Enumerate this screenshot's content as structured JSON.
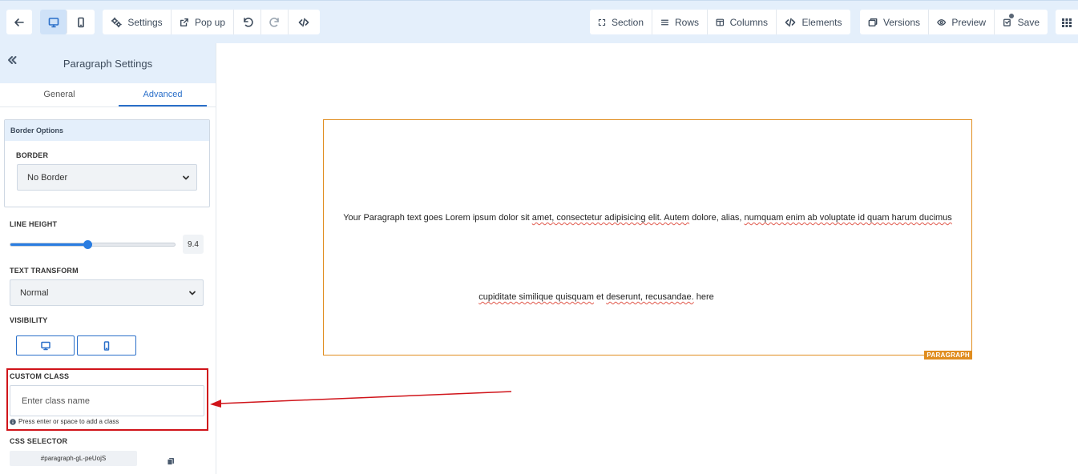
{
  "toolbar": {
    "settings_label": "Settings",
    "popup_label": "Pop up",
    "section_label": "Section",
    "rows_label": "Rows",
    "columns_label": "Columns",
    "elements_label": "Elements",
    "versions_label": "Versions",
    "preview_label": "Preview",
    "save_label": "Save"
  },
  "sidebar": {
    "title": "Paragraph Settings",
    "tabs": [
      {
        "label": "General",
        "active": false
      },
      {
        "label": "Advanced",
        "active": true
      }
    ],
    "border_options": {
      "heading": "Border Options",
      "border_label": "BORDER",
      "border_value": "No Border"
    },
    "line_height": {
      "label": "LINE HEIGHT",
      "value": "9.4",
      "fill_fraction": 0.47
    },
    "text_transform": {
      "label": "TEXT TRANSFORM",
      "value": "Normal"
    },
    "visibility": {
      "label": "VISIBILITY"
    },
    "custom_class": {
      "label": "CUSTOM CLASS",
      "placeholder": "Enter class name",
      "help": "Press enter or space to add a class"
    },
    "css_selector": {
      "label": "CSS SELECTOR",
      "value": "#paragraph-gL-peUojS"
    }
  },
  "canvas": {
    "paragraph": {
      "line1_a": "Your Paragraph text goes Lorem ipsum dolor sit ",
      "line1_b": "amet, consectetur adipisicing elit. Autem",
      "line1_c": " dolore, alias, ",
      "line1_d": "numquam enim ab voluptate id quam harum ducimus",
      "line2_a": "cupiditate similique quisquam",
      "line2_b": " et ",
      "line2_c": "deserunt, recusandae.",
      "line2_d": " here",
      "badge": "PARAGRAPH"
    }
  },
  "colors": {
    "accent": "#2a6fc9",
    "toolbar_bg": "#e4effb",
    "paragraph_outline": "#e08d1f",
    "annotation_red": "#d0141a"
  }
}
